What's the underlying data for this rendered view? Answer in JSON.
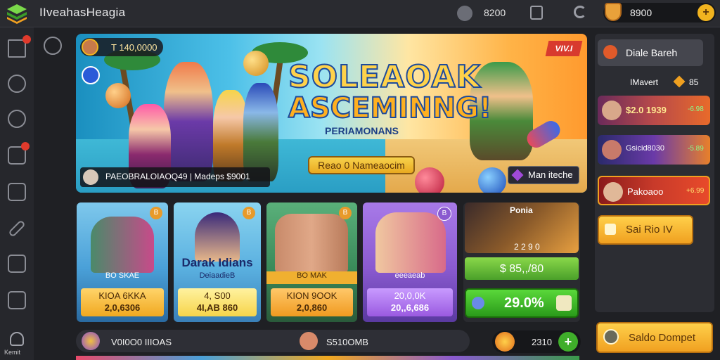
{
  "app": {
    "title": "IIveahasHeagia"
  },
  "topbar": {
    "stat_value": "8200",
    "coins": "8900"
  },
  "sidebar": {
    "bottom_label": "Kemit"
  },
  "banner": {
    "player_value": "T 140,0000",
    "title_line1": "SOLEAOAK",
    "title_line2": "ASCEMINNG!",
    "subtitle": "PERIAMONANS",
    "tag": "VIV.I",
    "cta_label": "Reao 0  Nameaocim",
    "more_label": "Man iteche",
    "footer_text": "PAEOBRALOIAOQ49  |  Madeps  $9001"
  },
  "cards": [
    {
      "badge": "B",
      "tag": "BO SKAE",
      "price_line1": "KIOA 6KKA",
      "price_line2": "2,0,6306",
      "price_style": "gold"
    },
    {
      "badge": "B",
      "title": "Darak Idians",
      "tag": "DeiaadieB",
      "price_line1": "4,  S00",
      "price_line2": "4I,AB 860",
      "price_style": "yellow"
    },
    {
      "badge": "B",
      "tag": "BO MAK",
      "price_line1": "KION 9OOK",
      "price_line2": "2,0,860",
      "price_style": "orange"
    },
    {
      "badge": "B",
      "tag": "eeeaeab",
      "price_line1": "20,0,0K",
      "price_line2": "20,,6,686",
      "price_style": "purple"
    },
    {
      "title": "Ponia",
      "value_small": "2 2 9 0",
      "value": "$ 85,,/80",
      "buy_label": "29.0%"
    }
  ],
  "bottom_bar": {
    "left_text": "V0I0O0 IIIOAS",
    "mid_text": "S510OMB",
    "right_value": "2310"
  },
  "right_panel": {
    "top_button": "Diale Bareh",
    "section_label": "IMavert",
    "section_value": "85",
    "items": [
      {
        "value": "$2.0 1939",
        "extra": "-6.98"
      },
      {
        "value": "Gsicid8030",
        "extra": "-5.89"
      },
      {
        "value": "Pakoaoo",
        "extra": "+6.99"
      }
    ],
    "gold_button": "Sai Rio IV",
    "bottom_button": "Saldo Dompet"
  },
  "colors": {
    "accent_gold": "#f2b41f",
    "accent_green": "#3fae2a",
    "alert_red": "#e03a2c"
  }
}
